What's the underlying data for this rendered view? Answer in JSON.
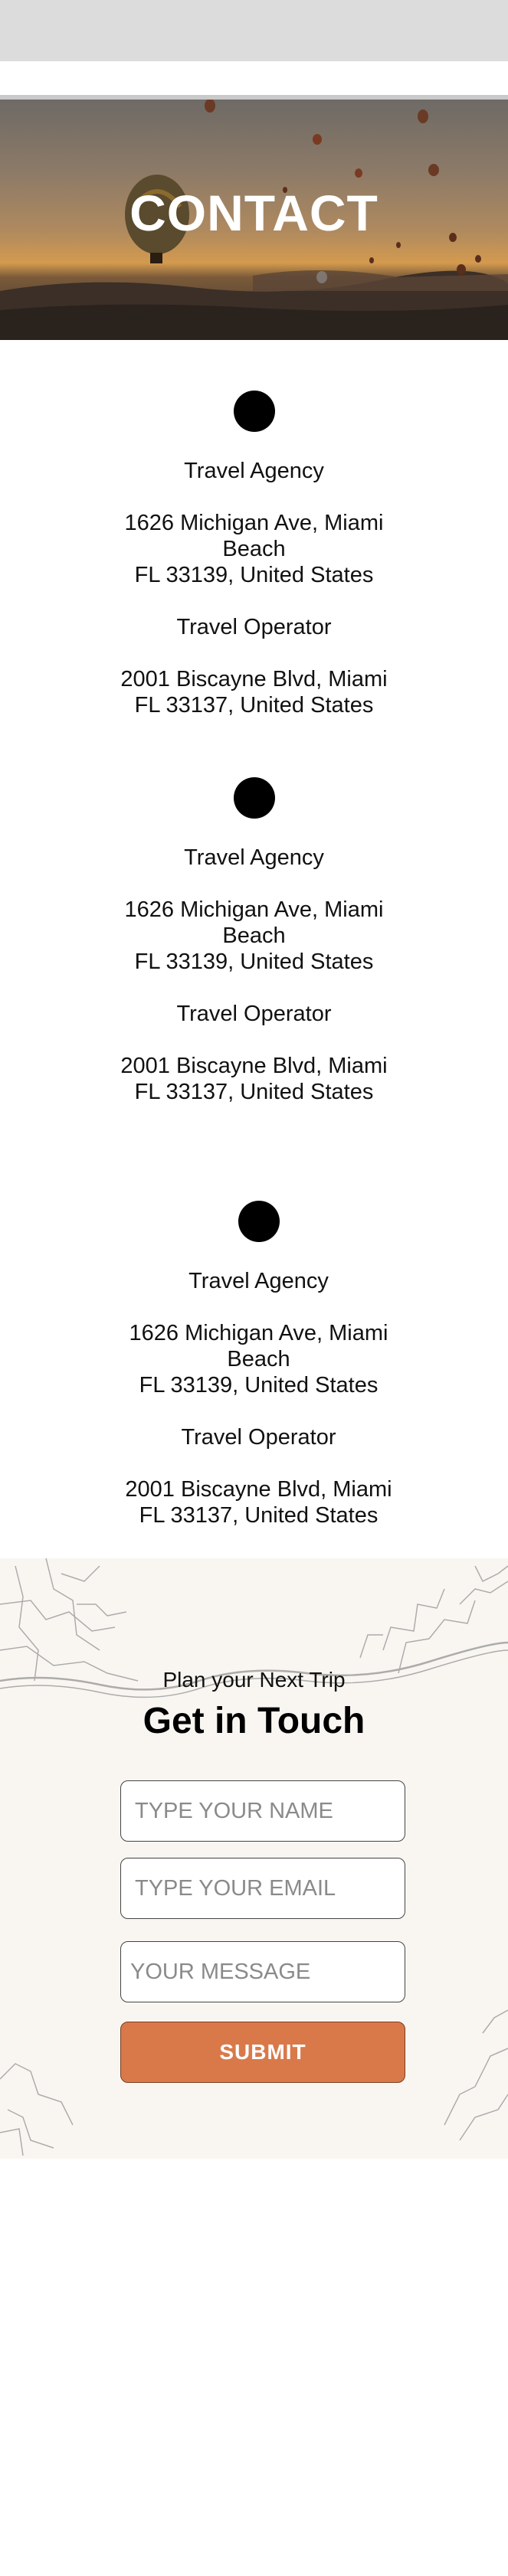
{
  "hero": {
    "title": "CONTACT"
  },
  "offices": [
    {
      "agency": "Travel Agency",
      "agency_addr_1": "1626 Michigan Ave, Miami",
      "agency_addr_2": "Beach",
      "agency_addr_3": "FL 33139, United States",
      "operator": "Travel Operator",
      "operator_addr_1": "2001 Biscayne Blvd, Miami",
      "operator_addr_2": "FL 33137, United States"
    },
    {
      "agency": "Travel Agency",
      "agency_addr_1": "1626 Michigan Ave, Miami",
      "agency_addr_2": "Beach",
      "agency_addr_3": "FL 33139, United States",
      "operator": "Travel Operator",
      "operator_addr_1": "2001 Biscayne Blvd, Miami",
      "operator_addr_2": "FL 33137, United States"
    },
    {
      "agency": "Travel Agency",
      "agency_addr_1": "1626 Michigan Ave, Miami",
      "agency_addr_2": "Beach",
      "agency_addr_3": "FL 33139, United States",
      "operator": "Travel Operator",
      "operator_addr_1": "2001 Biscayne Blvd, Miami",
      "operator_addr_2": "FL 33137, United States"
    }
  ],
  "contact": {
    "kicker": "Plan your Next Trip",
    "headline": "Get in Touch",
    "name_placeholder": "TYPE YOUR NAME",
    "email_placeholder": "TYPE YOUR EMAIL",
    "message_placeholder": "YOUR MESSAGE",
    "submit_label": "SUBMIT"
  },
  "colors": {
    "accent": "#d9794a",
    "form_background": "#f9f6f2",
    "top_bar": "#dcdcdc"
  }
}
